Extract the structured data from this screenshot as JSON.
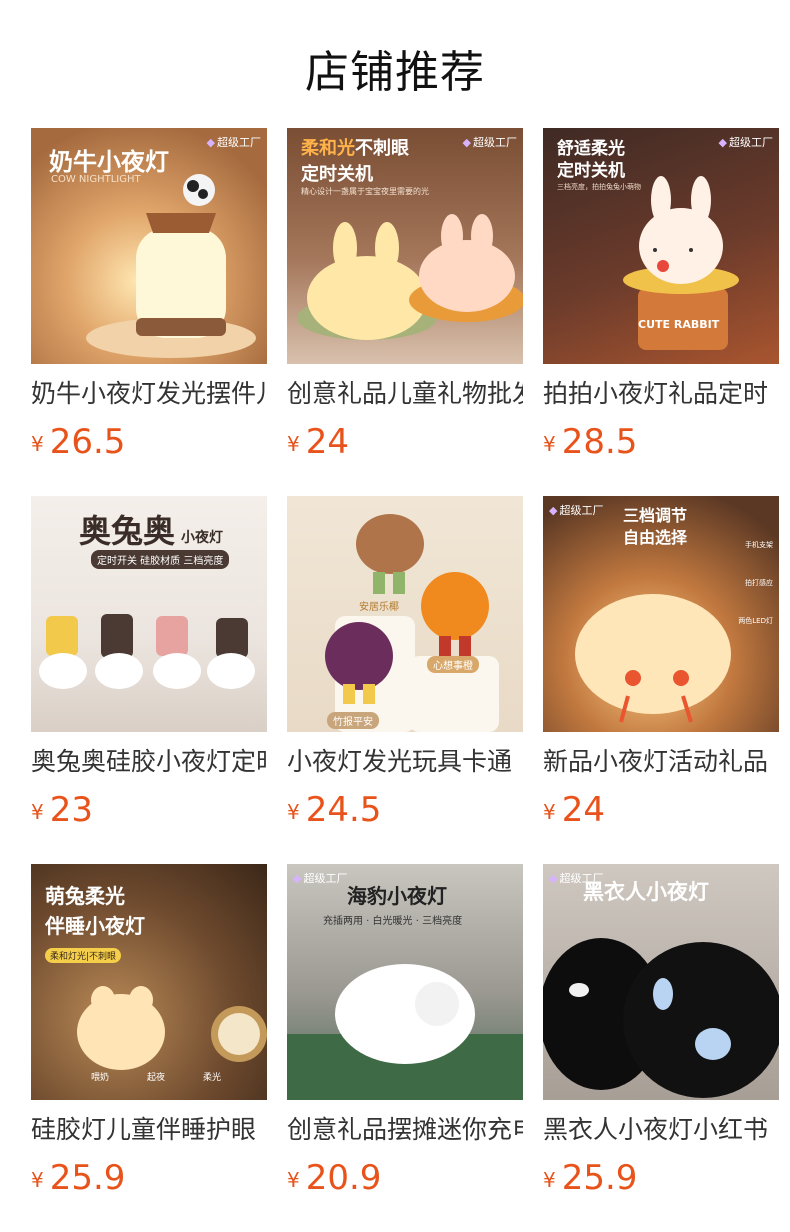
{
  "header": {
    "title": "店铺推荐"
  },
  "currency": "¥",
  "products": [
    {
      "name": "奶牛小夜灯发光摆件儿童",
      "price": "26.5",
      "img": {
        "headline": "奶牛小夜灯",
        "sub": "COW NIGHTLIGHT",
        "badge": "超级工厂"
      }
    },
    {
      "name": "创意礼品儿童礼物批发",
      "price": "24",
      "img": {
        "headline_a": "柔和光",
        "headline_b": "不刺眼",
        "headline2": "定时关机",
        "sub": "精心设计一盏属于宝宝夜里需要的光",
        "badge": "超级工厂"
      }
    },
    {
      "name": "拍拍小夜灯礼品定时",
      "price": "28.5",
      "img": {
        "headline": "舒适柔光",
        "headline2": "定时关机",
        "sub": "三档亮度，拍拍兔兔小萌物",
        "badge": "超级工厂",
        "label": "CUTE RABBIT"
      }
    },
    {
      "name": "奥兔奥硅胶小夜灯定时",
      "price": "23",
      "img": {
        "headline": "奥兔奥",
        "headline_small": "小夜灯",
        "sub": "定时开关 硅胶材质 三档亮度"
      }
    },
    {
      "name": "小夜灯发光玩具卡通",
      "price": "24.5",
      "img": {
        "tag1": "安居乐椰",
        "tag2": "心想事橙",
        "tag3": "竹报平安"
      }
    },
    {
      "name": "新品小夜灯活动礼品",
      "price": "24",
      "img": {
        "headline": "三档调节",
        "headline2": "自由选择",
        "badge": "超级工厂",
        "f1": "手机支架",
        "f2": "拍打感应",
        "f3": "两色LED灯"
      }
    },
    {
      "name": "硅胶灯儿童伴睡护眼",
      "price": "25.9",
      "img": {
        "headline": "萌兔柔光",
        "headline2": "伴睡小夜灯",
        "sub": "柔和灯光|不刺眼",
        "i1": "喂奶",
        "i2": "起夜",
        "i3": "柔光"
      }
    },
    {
      "name": "创意礼品摆摊迷你充电",
      "price": "20.9",
      "img": {
        "headline": "海豹小夜灯",
        "sub": "充插两用 · 白光暖光 · 三档亮度",
        "badge": "超级工厂"
      }
    },
    {
      "name": "黑衣人小夜灯小红书",
      "price": "25.9",
      "img": {
        "headline": "黑衣人小夜灯",
        "badge": "超级工厂"
      }
    }
  ]
}
